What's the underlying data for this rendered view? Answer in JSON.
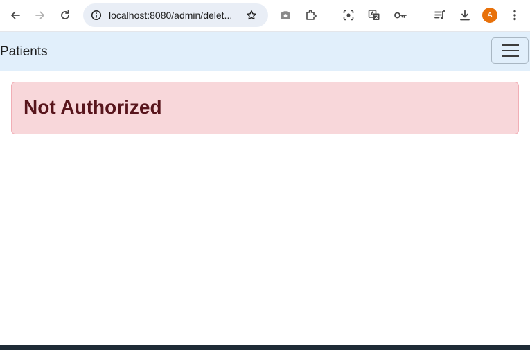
{
  "browser": {
    "url": "localhost:8080/admin/delet...",
    "profile_initial": "A",
    "icons": {
      "back": "arrow-left-icon",
      "forward": "arrow-right-icon",
      "reload": "reload-icon",
      "site_info": "info-icon",
      "bookmark": "star-icon",
      "screenshot": "camera-icon",
      "extensions": "puzzle-icon",
      "lens": "lens-icon",
      "translate": "translate-icon",
      "passwords": "key-icon",
      "reading_list": "media-queue-icon",
      "downloads": "download-icon",
      "menu": "kebab-menu-icon"
    }
  },
  "navbar": {
    "brand": "Patients",
    "toggler_icon": "hamburger-icon"
  },
  "alert": {
    "title": "Not Authorized",
    "colors": {
      "background": "#f8d7da",
      "border": "#f1aeb5",
      "text": "#58151c"
    }
  },
  "colors": {
    "navbar_bg": "#e1effb",
    "avatar_bg": "#e8710a"
  }
}
